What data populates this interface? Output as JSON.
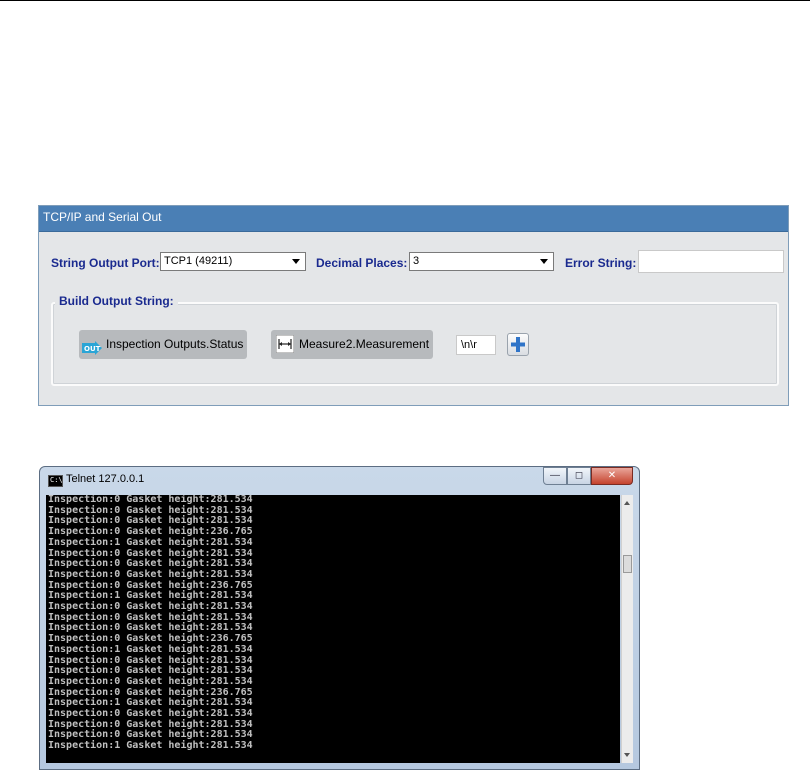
{
  "panel": {
    "title": "TCP/IP and Serial Out",
    "string_output_port_label": "String Output Port:",
    "string_output_port_value": "TCP1 (49211)",
    "decimal_places_label": "Decimal Places:",
    "decimal_places_value": "3",
    "error_string_label": "Error String:",
    "error_string_value": "",
    "build_output_label": "Build Output String:",
    "chips": [
      {
        "label": "Inspection Outputs.Status",
        "icon": "out-icon"
      },
      {
        "label": "Measure2.Measurement",
        "icon": "caliper-icon"
      }
    ],
    "terminator_value": "\\n\\r",
    "add_icon": "plus-icon"
  },
  "telnet": {
    "title": "Telnet 127.0.0.1",
    "lines": [
      "Inspection:0 Gasket height:281.534",
      "Inspection:0 Gasket height:281.534",
      "Inspection:0 Gasket height:281.534",
      "Inspection:0 Gasket height:236.765",
      "Inspection:1 Gasket height:281.534",
      "Inspection:0 Gasket height:281.534",
      "Inspection:0 Gasket height:281.534",
      "Inspection:0 Gasket height:281.534",
      "Inspection:0 Gasket height:236.765",
      "Inspection:1 Gasket height:281.534",
      "Inspection:0 Gasket height:281.534",
      "Inspection:0 Gasket height:281.534",
      "Inspection:0 Gasket height:281.534",
      "Inspection:0 Gasket height:236.765",
      "Inspection:1 Gasket height:281.534",
      "Inspection:0 Gasket height:281.534",
      "Inspection:0 Gasket height:281.534",
      "Inspection:0 Gasket height:281.534",
      "Inspection:0 Gasket height:236.765",
      "Inspection:1 Gasket height:281.534",
      "Inspection:0 Gasket height:281.534",
      "Inspection:0 Gasket height:281.534",
      "Inspection:0 Gasket height:281.534",
      "Inspection:1 Gasket height:281.534"
    ]
  }
}
